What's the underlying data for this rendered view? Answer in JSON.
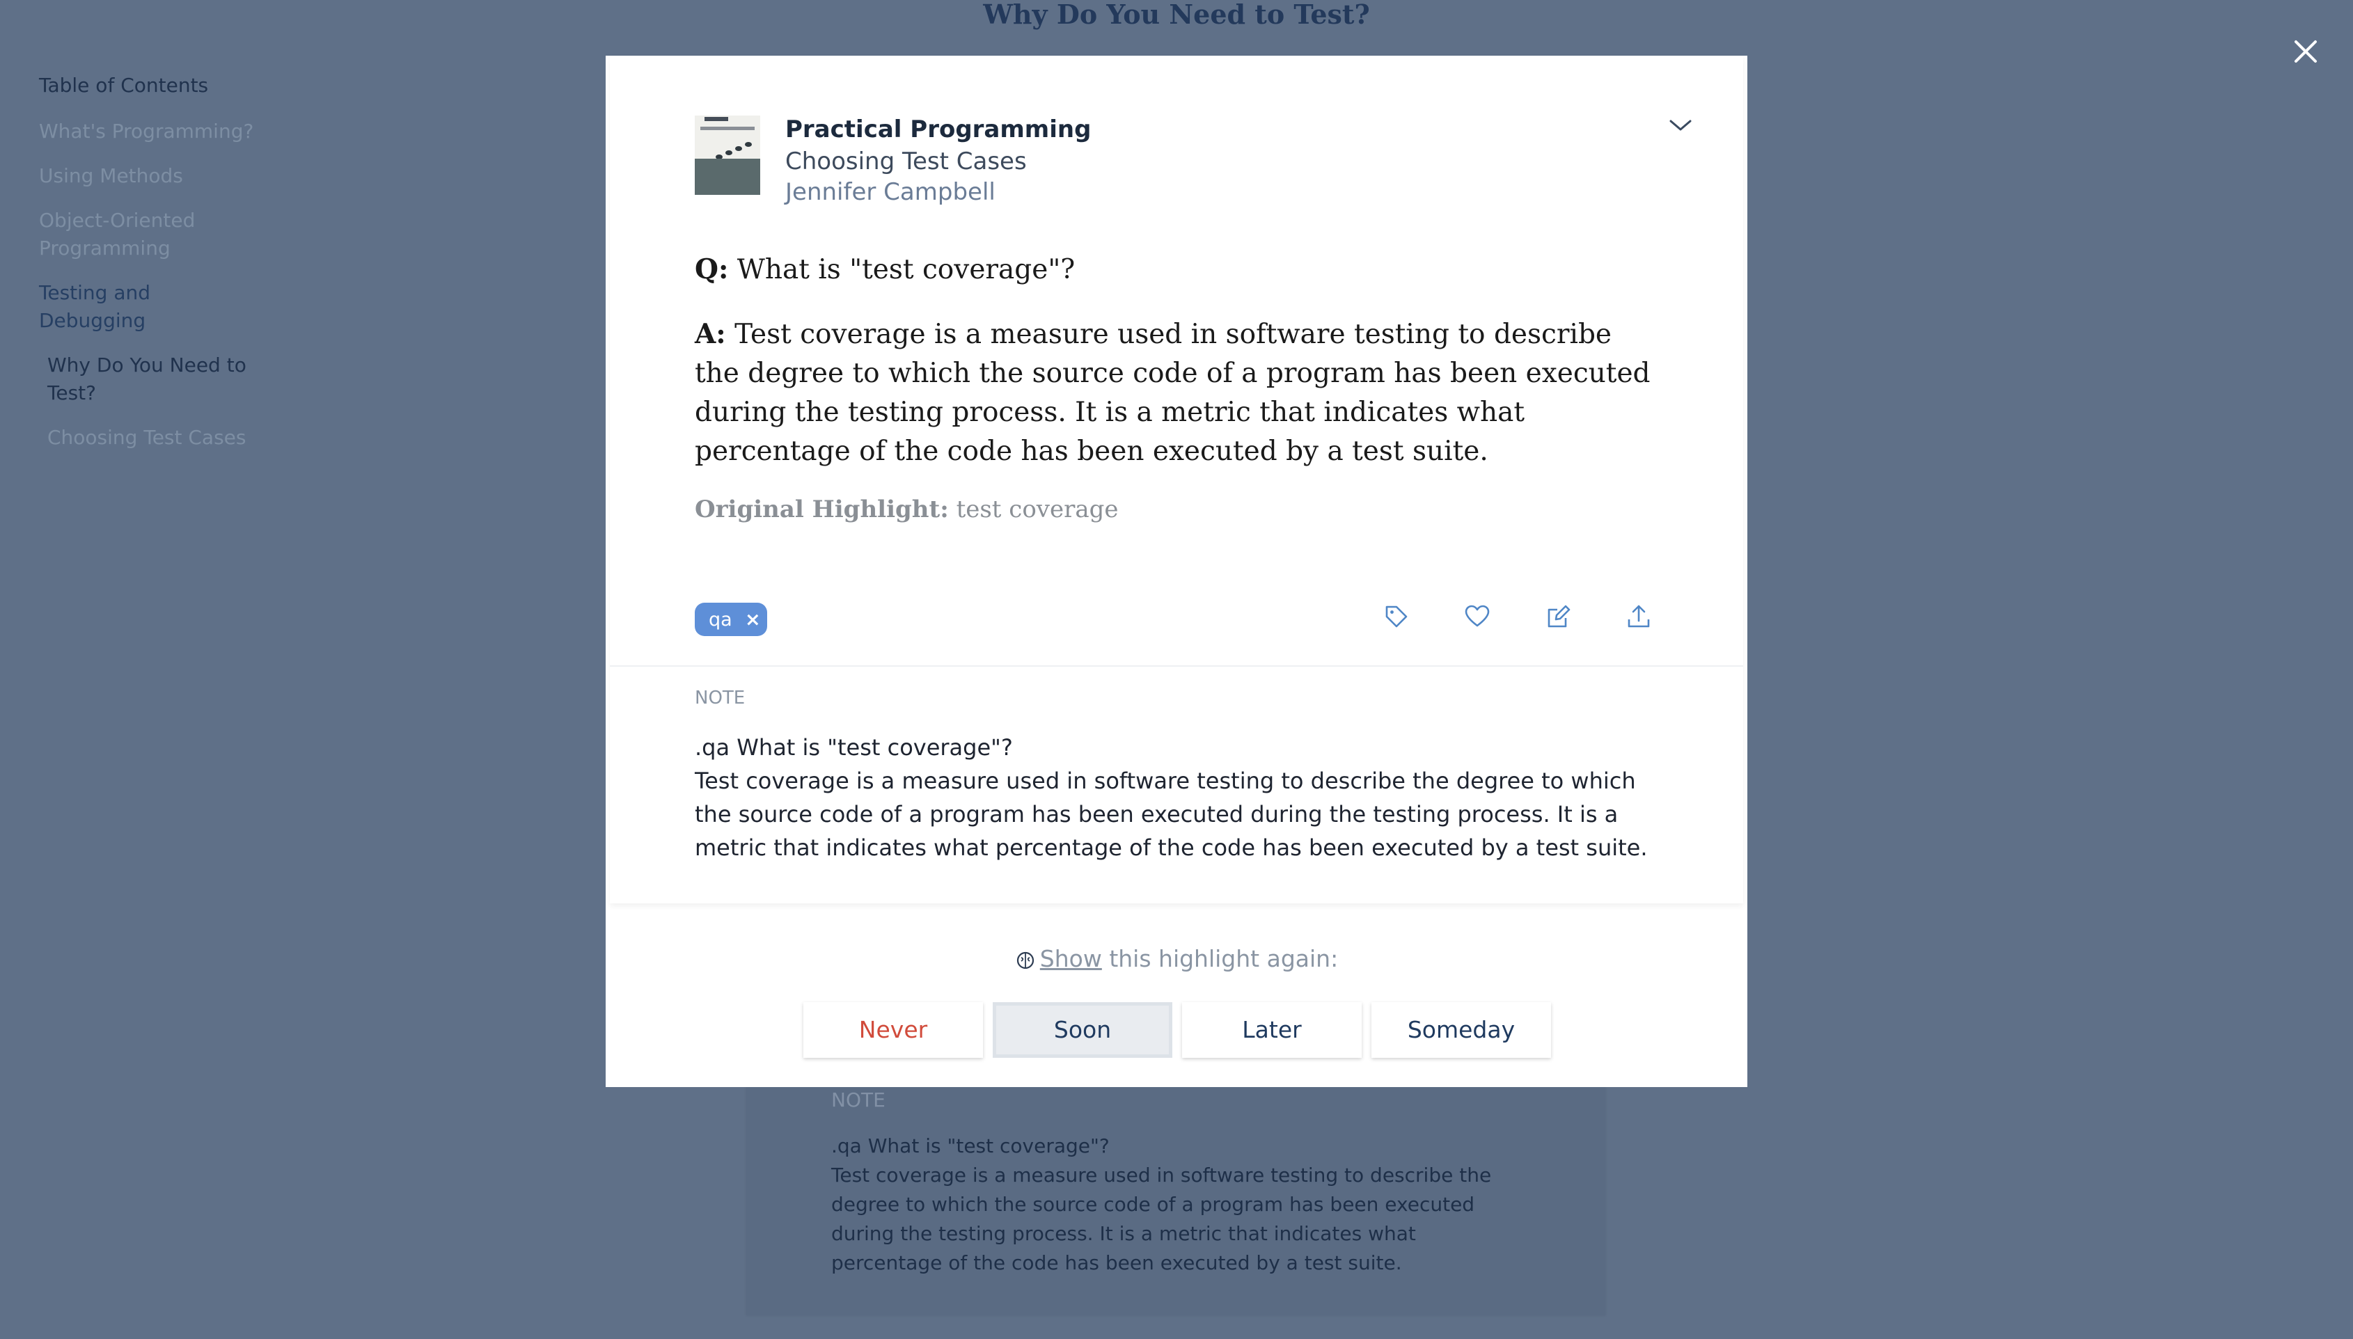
{
  "page": {
    "background_title": "Why Do You Need to Test?"
  },
  "toc": {
    "heading": "Table of Contents",
    "items": [
      {
        "label": "What's Programming?"
      },
      {
        "label": "Using Methods"
      },
      {
        "label": "Object-Oriented Programming"
      },
      {
        "label": "Testing and Debugging"
      },
      {
        "label": "Why Do You Need to Test?"
      },
      {
        "label": "Choosing Test Cases"
      }
    ]
  },
  "background_card": {
    "note_label": "NOTE",
    "note_text": ".qa What is \"test coverage\"?\nTest coverage is a measure used in software testing to describe the degree to which the source code of a program has been executed during the testing process. It is a metric that indicates what percentage of the code has been executed by a test suite."
  },
  "modal": {
    "book_title": "Practical Programming",
    "chapter": "Choosing Test Cases",
    "author": "Jennifer Campbell",
    "question_prefix": "Q:",
    "question": "What is \"test coverage\"?",
    "answer_prefix": "A:",
    "answer": "Test coverage is a measure used in software testing to describe the degree to which the source code of a program has been executed during the testing process. It is a metric that indicates what percentage of the code has been executed by a test suite.",
    "original_label": "Original Highlight:",
    "original_text": "test coverage",
    "tag": "qa",
    "tag_remove": "×",
    "note_label": "NOTE",
    "note_text": ".qa What is \"test coverage\"?\nTest coverage is a measure used in software testing to describe the degree to which the source code of a program has been executed during the testing process. It is a metric that indicates what percentage of the code has been executed by a test suite.",
    "show_link": "Show",
    "show_suffix": " this highlight again:",
    "buttons": {
      "never": "Never",
      "soon": "Soon",
      "later": "Later",
      "someday": "Someday"
    }
  },
  "colors": {
    "overlay_bg": "#5f7088",
    "tag_blue": "#5e8fd8",
    "never_red": "#d14b3b",
    "icon_blue": "#4f86c6"
  },
  "icons": [
    "close-icon",
    "chevron-down-icon",
    "tag-icon",
    "heart-icon",
    "edit-icon",
    "share-icon",
    "brain-icon"
  ]
}
